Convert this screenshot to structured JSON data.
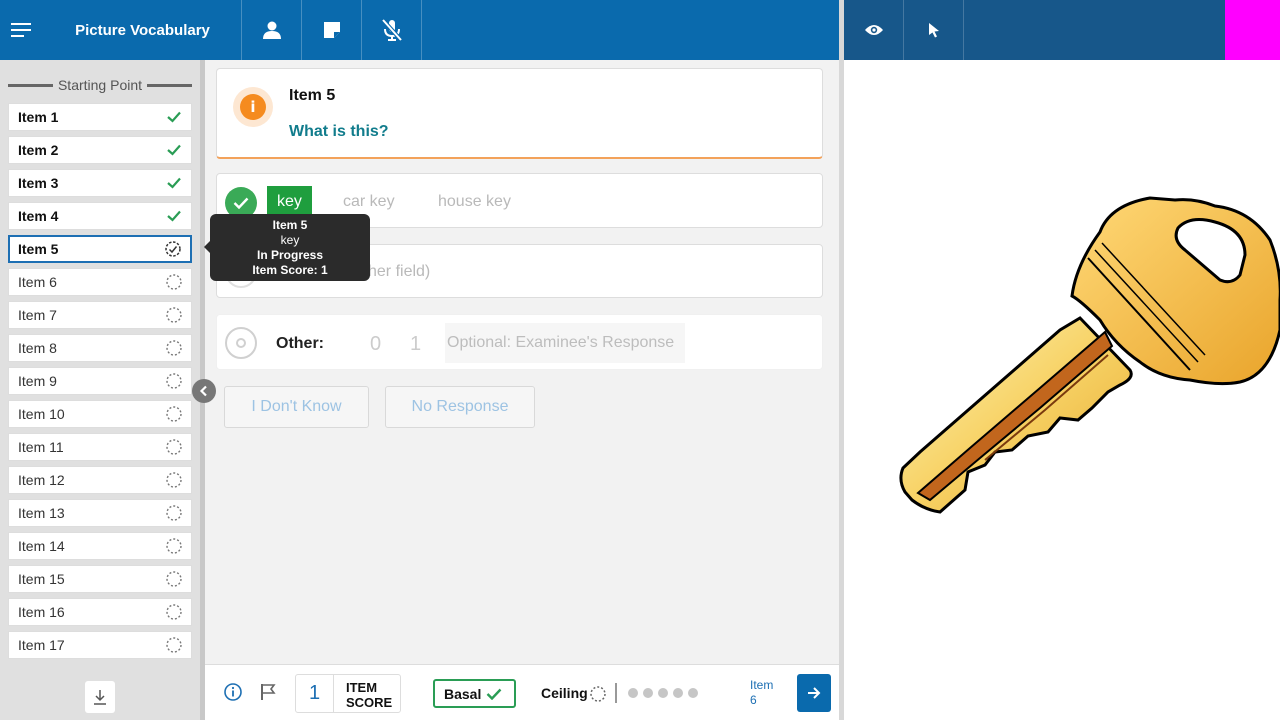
{
  "app": {
    "title": "Picture Vocabulary"
  },
  "sidebar": {
    "starting_point_label": "Starting Point",
    "items": [
      {
        "label": "Item 1",
        "status": "complete"
      },
      {
        "label": "Item 2",
        "status": "complete"
      },
      {
        "label": "Item 3",
        "status": "complete"
      },
      {
        "label": "Item 4",
        "status": "complete"
      },
      {
        "label": "Item 5",
        "status": "in-progress"
      },
      {
        "label": "Item 6",
        "status": "not-started"
      },
      {
        "label": "Item 7",
        "status": "not-started"
      },
      {
        "label": "Item 8",
        "status": "not-started"
      },
      {
        "label": "Item 9",
        "status": "not-started"
      },
      {
        "label": "Item 10",
        "status": "not-started"
      },
      {
        "label": "Item 11",
        "status": "not-started"
      },
      {
        "label": "Item 12",
        "status": "not-started"
      },
      {
        "label": "Item 13",
        "status": "not-started"
      },
      {
        "label": "Item 14",
        "status": "not-started"
      },
      {
        "label": "Item 15",
        "status": "not-started"
      },
      {
        "label": "Item 16",
        "status": "not-started"
      },
      {
        "label": "Item 17",
        "status": "not-started"
      }
    ]
  },
  "tooltip": {
    "title": "Item 5",
    "word": "key",
    "status": "In Progress",
    "score": "Item Score: 1"
  },
  "question": {
    "item_label": "Item 5",
    "prompt": "What is this?"
  },
  "responses": {
    "correct": "key",
    "alt1": "car key",
    "alt2": "house key"
  },
  "other_field": {
    "placeholder_fragment": "her field)"
  },
  "other": {
    "label": "Other:",
    "score0": "0",
    "score1": "1",
    "input_placeholder": "Optional: Examinee's Response"
  },
  "buttons": {
    "dont_know": "I Don't Know",
    "no_response": "No Response"
  },
  "footer": {
    "item_score_value": "1",
    "item_score_line1": "ITEM",
    "item_score_line2": "SCORE",
    "basal_label": "Basal",
    "ceiling_label": "Ceiling",
    "next_line1": "Item",
    "next_line2": "6"
  },
  "colors": {
    "header_blue": "#0a6aad",
    "header_dark": "#17578a",
    "correct_green": "#1f9e3e",
    "accent_orange": "#f58b1f",
    "prompt_teal": "#117c8c",
    "debug_magenta": "#ff00ff"
  },
  "icons": {
    "menu": "menu-icon",
    "examinee": "person-icon",
    "notes": "note-icon",
    "mic": "mic-off-icon",
    "preview": "eye-icon",
    "pointer": "cursor-icon"
  }
}
